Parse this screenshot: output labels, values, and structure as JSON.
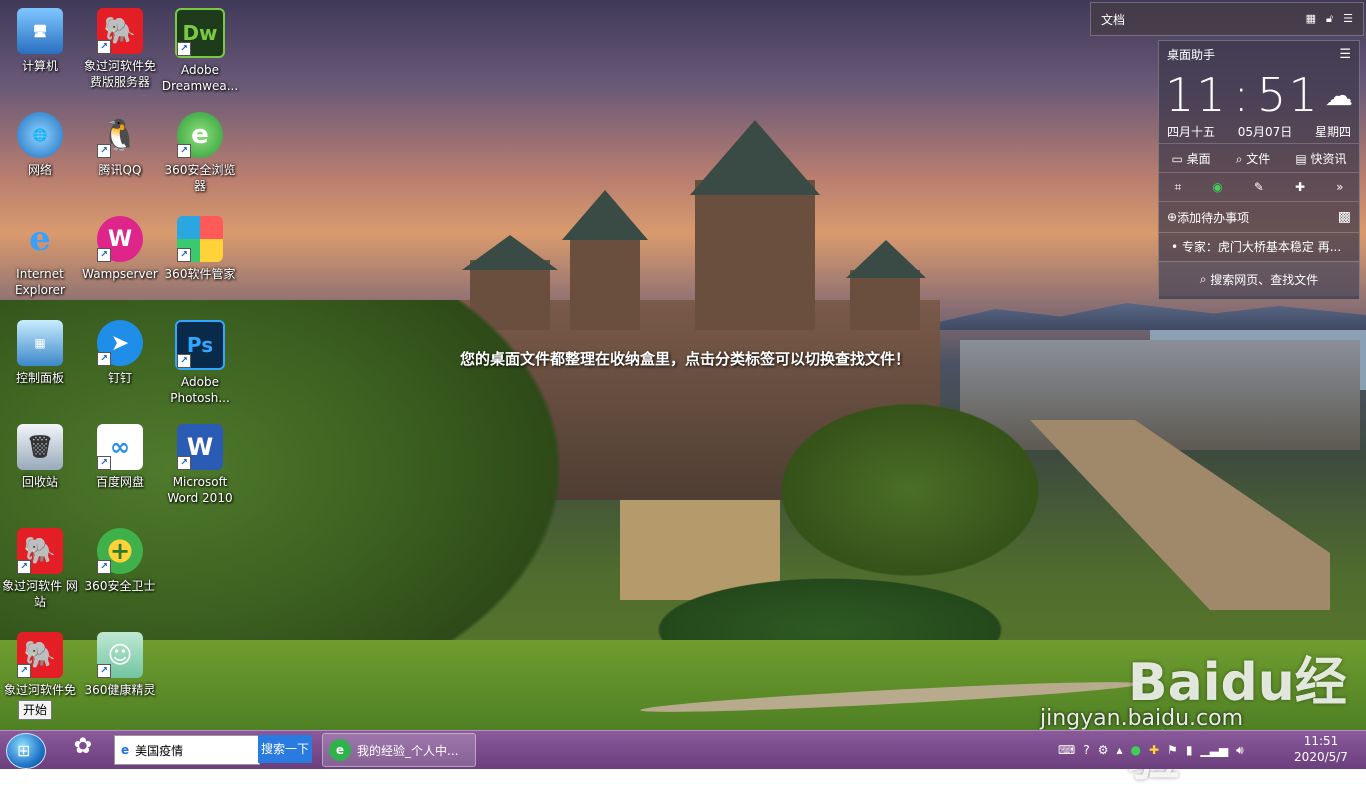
{
  "desktop_icons": [
    {
      "label": "计算机",
      "icon": "computer-icon",
      "color": "#3a8ee0",
      "shortcut": false
    },
    {
      "label": "象过河软件免费版服务器",
      "icon": "elephant-icon",
      "color": "#e31e24",
      "shortcut": true
    },
    {
      "label": "Adobe Dreamwea...",
      "icon": "dreamweaver-icon",
      "color": "#1e3b1b",
      "shortcut": true
    },
    {
      "label": "网络",
      "icon": "network-icon",
      "color": "#3da5e0",
      "shortcut": false
    },
    {
      "label": "腾讯QQ",
      "icon": "qq-icon",
      "color": "#111111",
      "shortcut": true
    },
    {
      "label": "360安全浏览器",
      "icon": "360-browser-icon",
      "color": "#31b34a",
      "shortcut": true
    },
    {
      "label": "Internet Explorer",
      "icon": "ie-icon",
      "color": "#1e6fd0",
      "shortcut": false
    },
    {
      "label": "Wampserver",
      "icon": "wampserver-icon",
      "color": "#e0258a",
      "shortcut": true
    },
    {
      "label": "360软件管家",
      "icon": "360-software-icon",
      "color": "#2aa7e0",
      "shortcut": true
    },
    {
      "label": "控制面板",
      "icon": "control-panel-icon",
      "color": "#3b88c9",
      "shortcut": false
    },
    {
      "label": "钉钉",
      "icon": "dingtalk-icon",
      "color": "#1e8ee9",
      "shortcut": true
    },
    {
      "label": "Adobe Photosh...",
      "icon": "photoshop-icon",
      "color": "#0a2a4a",
      "shortcut": true
    },
    {
      "label": "回收站",
      "icon": "recycle-bin-icon",
      "color": "#b9c6d3",
      "shortcut": false
    },
    {
      "label": "百度网盘",
      "icon": "baidu-netdisk-icon",
      "color": "#ffffff",
      "shortcut": true
    },
    {
      "label": "Microsoft Word 2010",
      "icon": "word-icon",
      "color": "#2a5bb5",
      "shortcut": true
    },
    {
      "label": "象过河软件 网站",
      "icon": "elephant-icon",
      "color": "#e31e24",
      "shortcut": true
    },
    {
      "label": "360安全卫士",
      "icon": "360-safe-icon",
      "color": "#3fb04a",
      "shortcut": true
    },
    {
      "label": "象过河软件免",
      "icon": "elephant-icon",
      "color": "#e31e24",
      "shortcut": true
    },
    {
      "label": "360健康精灵",
      "icon": "360-health-icon",
      "color": "#72c5a0",
      "shortcut": true
    }
  ],
  "center_message": "您的桌面文件都整理在收纳盒里，点击分类标签可以切换查找文件！",
  "doc_box": {
    "title": "文档"
  },
  "assistant": {
    "title": "桌面助手",
    "hour": "11",
    "minute": "51",
    "lunar": "四月十五",
    "date": "05月07日",
    "weekday": "星期四",
    "tabs": [
      "桌面",
      "文件",
      "快资讯"
    ],
    "add_todo": "添加待办事项",
    "news": "• 专家：虎门大桥基本稳定 再...",
    "search": "搜索网页、查找文件"
  },
  "watermark": {
    "logo": "Baidu经验",
    "url": "jingyan.baidu.com"
  },
  "start_tooltip": "开始",
  "taskbar": {
    "search_value": "美国疫情",
    "search_button": "搜索一下",
    "task_label": "我的经验_个人中...",
    "time": "11:51",
    "date": "2020/5/7"
  }
}
